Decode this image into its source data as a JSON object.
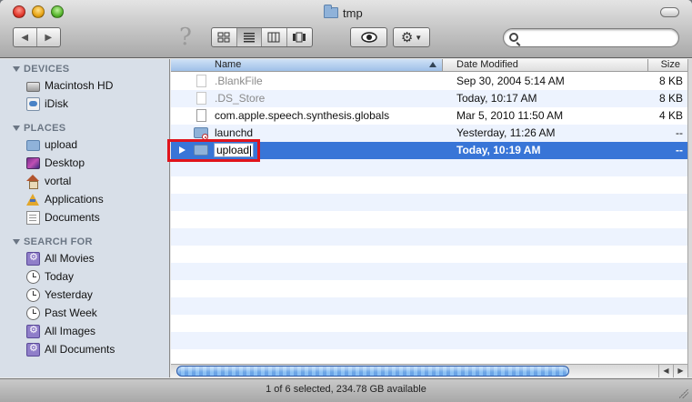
{
  "window": {
    "title": "tmp",
    "status_text": "1 of 6 selected, 234.78 GB available"
  },
  "toolbar": {
    "back_icon": "◀",
    "forward_icon": "▶",
    "help_glyph": "?",
    "search_placeholder": "",
    "view_modes": [
      "icon-view",
      "list-view",
      "column-view",
      "cover-flow-view"
    ],
    "active_view": "list-view"
  },
  "sidebar": {
    "devices": {
      "header": "DEVICES",
      "items": [
        {
          "label": "Macintosh HD",
          "icon": "hard-drive-icon"
        },
        {
          "label": "iDisk",
          "icon": "idisk-icon"
        }
      ]
    },
    "places": {
      "header": "PLACES",
      "items": [
        {
          "label": "upload",
          "icon": "folder-icon"
        },
        {
          "label": "Desktop",
          "icon": "desktop-icon"
        },
        {
          "label": "vortal",
          "icon": "home-icon"
        },
        {
          "label": "Applications",
          "icon": "applications-icon"
        },
        {
          "label": "Documents",
          "icon": "documents-icon"
        }
      ]
    },
    "search_for": {
      "header": "SEARCH FOR",
      "items": [
        {
          "label": "All Movies",
          "icon": "smart-folder-icon"
        },
        {
          "label": "Today",
          "icon": "clock-icon"
        },
        {
          "label": "Yesterday",
          "icon": "clock-icon"
        },
        {
          "label": "Past Week",
          "icon": "clock-icon"
        },
        {
          "label": "All Images",
          "icon": "smart-folder-icon"
        },
        {
          "label": "All Documents",
          "icon": "smart-folder-icon"
        }
      ]
    }
  },
  "file_list": {
    "columns": {
      "name": "Name",
      "date": "Date Modified",
      "size": "Size"
    },
    "sorted_by": "Name",
    "rows": [
      {
        "name": ".BlankFile",
        "date": "Sep 30, 2004 5:14 AM",
        "size": "8 KB",
        "icon": "file-icon",
        "hidden": true
      },
      {
        "name": ".DS_Store",
        "date": "Today, 10:17 AM",
        "size": "8 KB",
        "icon": "file-icon",
        "hidden": true
      },
      {
        "name": "com.apple.speech.synthesis.globals",
        "date": "Mar 5, 2010 11:50 AM",
        "size": "4 KB",
        "icon": "file-icon",
        "hidden": false
      },
      {
        "name": "launchd",
        "date": "Yesterday, 11:26 AM",
        "size": "--",
        "icon": "restricted-folder-icon",
        "hidden": false
      },
      {
        "name": "upload",
        "date": "Today, 10:19 AM",
        "size": "--",
        "icon": "folder-icon",
        "selected": true,
        "renaming": true
      }
    ]
  },
  "colors": {
    "selection": "#3875d7",
    "sidebar_bg": "#d8dfe8",
    "alternate_row": "#edf3fe",
    "annotation_box": "#e0141c"
  }
}
